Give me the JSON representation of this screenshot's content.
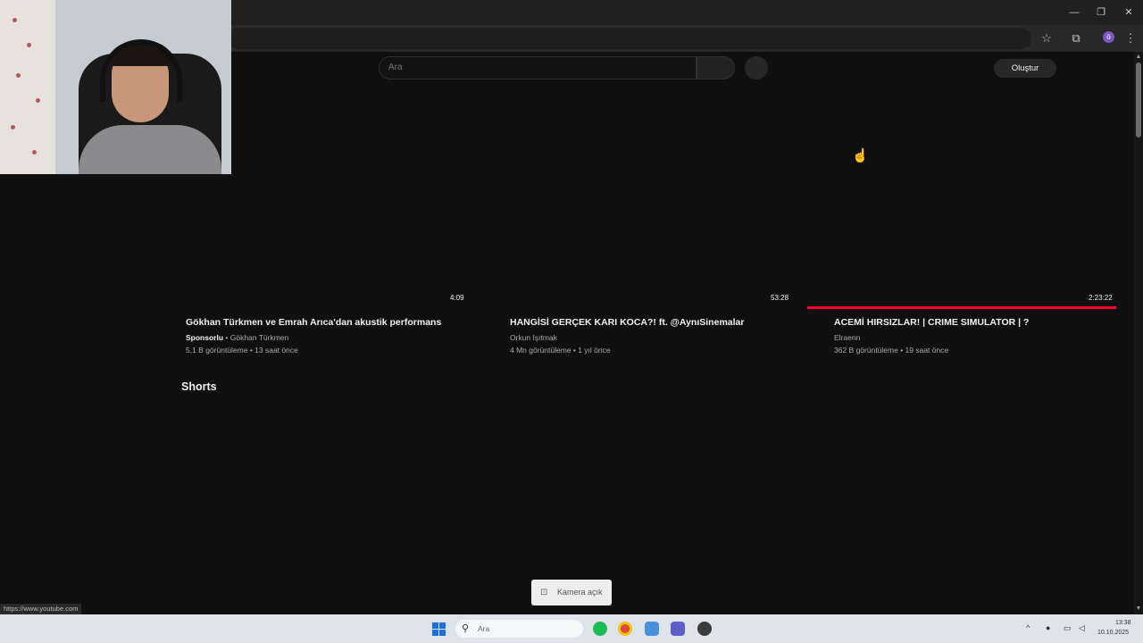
{
  "window": {
    "minimize": "—",
    "restore": "❐",
    "close": "✕"
  },
  "browser": {
    "bookmark_icon": "star-icon",
    "extensions_icon": "puzzle-icon",
    "profile_letter": "ö",
    "menu_icon": "kebab-menu-icon",
    "status_url": "https://www.youtube.com"
  },
  "header": {
    "search_placeholder": "Ara",
    "create_label": "Oluştur"
  },
  "videos": [
    {
      "duration": "4:09",
      "title": "Gökhan Türkmen ve Emrah Arıca'dan akustik performans",
      "sponsored_label": "Sponsorlu",
      "channel": " • Gökhan Türkmen",
      "meta": "5,1 B görüntüleme • 13 saat önce"
    },
    {
      "duration": "53:28",
      "title": "HANGİSİ GERÇEK KARI KOCA?! ft. @AynıSinemalar",
      "channel": "Orkun Işıtmak",
      "meta": "4 Mn görüntüleme • 1 yıl önce"
    },
    {
      "duration": "2:23:22",
      "title": "ACEMİ HIRSIZLAR! | CRIME SIMULATOR | ?",
      "channel": "Elraenn",
      "meta": "362 B görüntüleme • 19 saat önce",
      "watched_fraction": 1.0
    }
  ],
  "shorts_heading": "Shorts",
  "camera_notice": "Kamera açık",
  "taskbar": {
    "search_placeholder": "Ara",
    "time": "13:38",
    "date": "10.10.2025"
  },
  "colors": {
    "background": "#0f0f0f",
    "accent_red": "#ff0033"
  }
}
